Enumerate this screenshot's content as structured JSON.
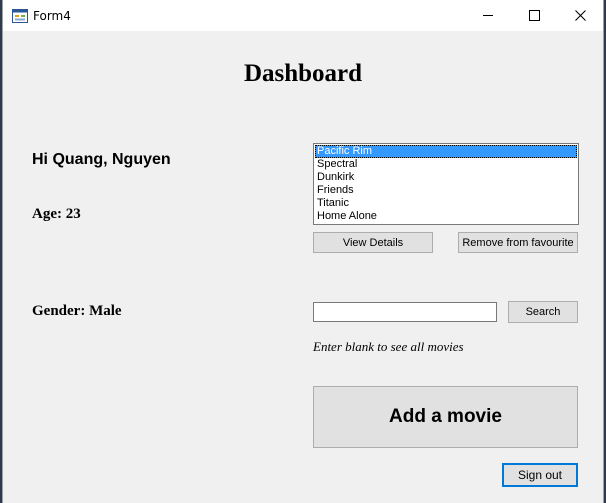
{
  "window": {
    "title": "Form4"
  },
  "dashboard": {
    "heading": "Dashboard",
    "greeting": "Hi Quang, Nguyen",
    "age_label": "Age: 23",
    "gender_label": "Gender: Male"
  },
  "favourites": {
    "items": [
      "Pacific Rim",
      "Spectral",
      "Dunkirk",
      "Friends",
      "Titanic",
      "Home Alone"
    ],
    "selected": "Pacific Rim",
    "view_details_label": "View Details",
    "remove_label": "Remove from favourite"
  },
  "search": {
    "value": "",
    "button_label": "Search",
    "hint": "Enter blank to see all movies"
  },
  "actions": {
    "add_movie_label": "Add a movie",
    "sign_out_label": "Sign out"
  },
  "icons": {
    "app": "form-icon",
    "minimize": "minimize-icon",
    "maximize": "maximize-icon",
    "close": "close-icon"
  },
  "colors": {
    "selection": "#3399ff",
    "focus_border": "#0078d7",
    "form_background": "#f0f0f0"
  }
}
